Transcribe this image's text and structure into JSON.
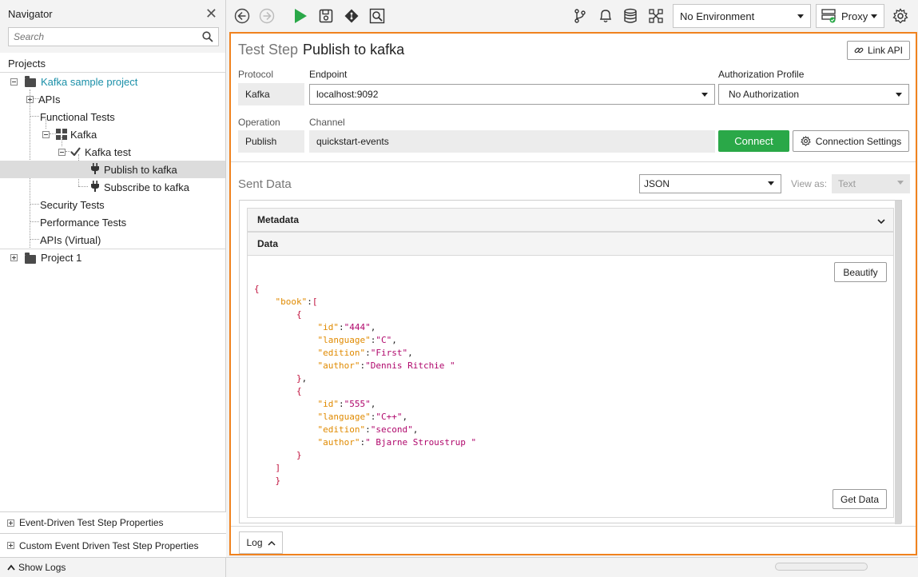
{
  "navigator": {
    "title": "Navigator",
    "search_placeholder": "Search",
    "projects_label": "Projects",
    "tree": [
      {
        "label": "Kafka sample project",
        "type": "project",
        "expanded": true
      },
      {
        "label": "APIs",
        "type": "group"
      },
      {
        "label": "Functional Tests",
        "type": "group"
      },
      {
        "label": "Kafka",
        "type": "suite"
      },
      {
        "label": "Kafka test",
        "type": "test"
      },
      {
        "label": "Publish to kafka",
        "type": "step",
        "selected": true
      },
      {
        "label": "Subscribe to kafka",
        "type": "step"
      },
      {
        "label": "Security Tests",
        "type": "group"
      },
      {
        "label": "Performance Tests",
        "type": "group"
      },
      {
        "label": "APIs (Virtual)",
        "type": "group"
      },
      {
        "label": "Project 1",
        "type": "project",
        "expanded": false
      }
    ],
    "bottom_panels": [
      "Event-Driven Test Step Properties",
      "Custom Event Driven Test Step Properties"
    ]
  },
  "statusbar": {
    "show_logs": "Show Logs"
  },
  "toolbar": {
    "environment": "No Environment",
    "proxy": "Proxy"
  },
  "step": {
    "prefix": "Test Step",
    "name": "Publish to kafka",
    "link_api": "Link API",
    "protocol_label": "Protocol",
    "protocol_value": "Kafka",
    "endpoint_label": "Endpoint",
    "endpoint_value": "localhost:9092",
    "auth_label": "Authorization Profile",
    "auth_value": "No Authorization",
    "operation_label": "Operation",
    "operation_value": "Publish",
    "channel_label": "Channel",
    "channel_value": "quickstart-events",
    "connect": "Connect",
    "connection_settings": "Connection Settings"
  },
  "sent_data": {
    "title": "Sent Data",
    "format": "JSON",
    "view_as_label": "View as:",
    "view_as_value": "Text",
    "metadata_label": "Metadata",
    "data_label": "Data",
    "beautify": "Beautify",
    "get_data": "Get Data",
    "json_lines": [
      {
        "indent": 0,
        "parts": [
          [
            "p",
            "{"
          ]
        ]
      },
      {
        "indent": 1,
        "parts": [
          [
            "k",
            "\"book\""
          ],
          [
            "p",
            ":"
          ],
          [
            "p",
            "["
          ]
        ]
      },
      {
        "indent": 2,
        "parts": [
          [
            "p",
            "{"
          ]
        ]
      },
      {
        "indent": 3,
        "parts": [
          [
            "k",
            "\"id\""
          ],
          [
            "p",
            ":"
          ],
          [
            "v",
            "\"444\""
          ],
          [
            "p",
            ","
          ]
        ]
      },
      {
        "indent": 3,
        "parts": [
          [
            "k",
            "\"language\""
          ],
          [
            "p",
            ":"
          ],
          [
            "v",
            "\"C\""
          ],
          [
            "p",
            ","
          ]
        ]
      },
      {
        "indent": 3,
        "parts": [
          [
            "k",
            "\"edition\""
          ],
          [
            "p",
            ":"
          ],
          [
            "v",
            "\"First\""
          ],
          [
            "p",
            ","
          ]
        ]
      },
      {
        "indent": 3,
        "parts": [
          [
            "k",
            "\"author\""
          ],
          [
            "p",
            ":"
          ],
          [
            "v",
            "\"Dennis Ritchie \""
          ]
        ]
      },
      {
        "indent": 2,
        "parts": [
          [
            "p",
            "}"
          ],
          [
            "p",
            ","
          ]
        ]
      },
      {
        "indent": 2,
        "parts": [
          [
            "p",
            "{"
          ]
        ]
      },
      {
        "indent": 3,
        "parts": [
          [
            "k",
            "\"id\""
          ],
          [
            "p",
            ":"
          ],
          [
            "v",
            "\"555\""
          ],
          [
            "p",
            ","
          ]
        ]
      },
      {
        "indent": 3,
        "parts": [
          [
            "k",
            "\"language\""
          ],
          [
            "p",
            ":"
          ],
          [
            "v",
            "\"C++\""
          ],
          [
            "p",
            ","
          ]
        ]
      },
      {
        "indent": 3,
        "parts": [
          [
            "k",
            "\"edition\""
          ],
          [
            "p",
            ":"
          ],
          [
            "v",
            "\"second\""
          ],
          [
            "p",
            ","
          ]
        ]
      },
      {
        "indent": 3,
        "parts": [
          [
            "k",
            "\"author\""
          ],
          [
            "p",
            ":"
          ],
          [
            "v",
            "\" Bjarne Stroustrup \""
          ]
        ]
      },
      {
        "indent": 2,
        "parts": [
          [
            "p",
            "}"
          ]
        ]
      },
      {
        "indent": 1,
        "parts": [
          [
            "p",
            "]"
          ]
        ]
      },
      {
        "indent": 1,
        "parts": [
          [
            "p",
            "}"
          ]
        ]
      }
    ]
  },
  "log": {
    "label": "Log"
  },
  "colors": {
    "accent_border": "#f0821e",
    "connect_green": "#2aa848",
    "project_link": "#1a8fa8",
    "run_green": "#2aa848"
  }
}
